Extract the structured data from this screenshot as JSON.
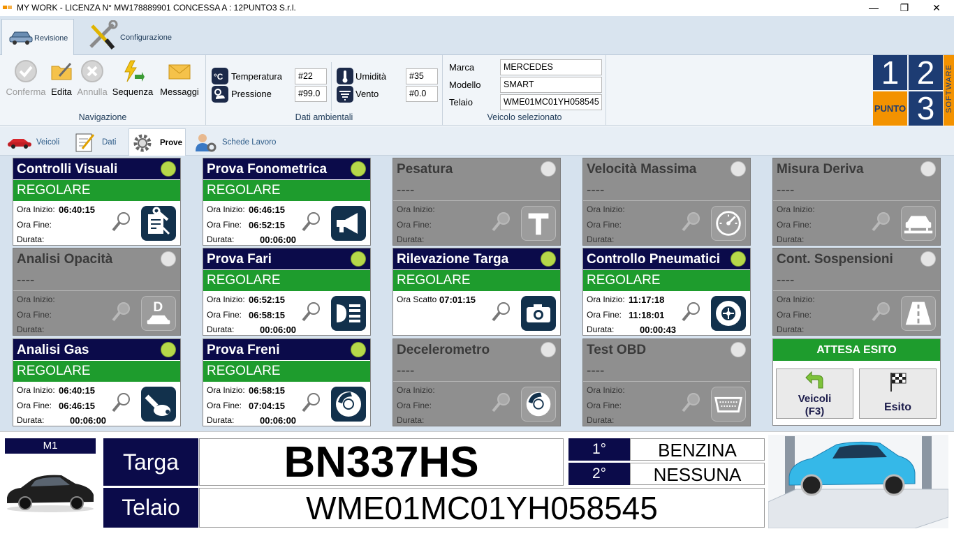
{
  "window": {
    "title": "MY WORK - LICENZA N° MW178889901 CONCESSA A : 12PUNTO3 S.r.l.",
    "minimize": "—",
    "restore": "❐",
    "close": "✕"
  },
  "ribbon_tabs": [
    {
      "label": "Revisione",
      "icon": "car-icon"
    },
    {
      "label": "Configurazione",
      "icon": "tools-icon"
    }
  ],
  "navigation": {
    "group_label": "Navigazione",
    "buttons": [
      {
        "label": "Conferma",
        "icon": "check-icon",
        "enabled": false
      },
      {
        "label": "Edita",
        "icon": "edit-folder-icon",
        "enabled": true
      },
      {
        "label": "Annulla",
        "icon": "cancel-icon",
        "enabled": false
      },
      {
        "label": "Sequenza",
        "icon": "lightning-arrow-icon",
        "enabled": true
      },
      {
        "label": "Messaggi",
        "icon": "envelope-icon",
        "enabled": true
      }
    ]
  },
  "ambient": {
    "group_label": "Dati ambientali",
    "temperatura": {
      "label": "Temperatura",
      "value": "#22"
    },
    "pressione": {
      "label": "Pressione",
      "value": "#99.0"
    },
    "umidita": {
      "label": "Umidità",
      "value": "#35"
    },
    "vento": {
      "label": "Vento",
      "value": "#0.0"
    }
  },
  "vehicle": {
    "group_label": "Veicolo selezionato",
    "marca": {
      "label": "Marca",
      "value": "MERCEDES"
    },
    "modello": {
      "label": "Modello",
      "value": "SMART"
    },
    "telaio": {
      "label": "Telaio",
      "value": "WME01MC01YH058545"
    }
  },
  "logo": {
    "one": "1",
    "two": "2",
    "three": "3",
    "punto": "PUNTO",
    "software": "SOFTWARE"
  },
  "subtabs": [
    {
      "label": "Veicoli"
    },
    {
      "label": "Dati"
    },
    {
      "label": "Prove"
    },
    {
      "label": "Schede Lavoro"
    }
  ],
  "row_labels": {
    "inizio": "Ora Inizio:",
    "fine": "Ora Fine:",
    "durata": "Durata:",
    "scatto": "Ora Scatto"
  },
  "cards": [
    {
      "title": "Controlli Visuali",
      "status": "REGOLARE",
      "active": true,
      "inizio": "06:40:15",
      "fine": "",
      "durata": "",
      "icon": "checklist-wrench-icon"
    },
    {
      "title": "Prova Fonometrica",
      "status": "REGOLARE",
      "active": true,
      "inizio": "06:46:15",
      "fine": "06:52:15",
      "durata": "00:06:00",
      "icon": "horn-icon"
    },
    {
      "title": "Pesatura",
      "status": "----",
      "active": false,
      "inizio": "",
      "fine": "",
      "durata": "",
      "icon": "weight-icon"
    },
    {
      "title": "Velocità Massima",
      "status": "----",
      "active": false,
      "inizio": "",
      "fine": "",
      "durata": "",
      "icon": "speedometer-icon"
    },
    {
      "title": "Misura Deriva",
      "status": "----",
      "active": false,
      "inizio": "",
      "fine": "",
      "durata": "",
      "icon": "car-lift-icon"
    },
    {
      "title": "Analisi Opacità",
      "status": "----",
      "active": false,
      "inizio": "",
      "fine": "",
      "durata": "",
      "icon": "diesel-car-icon"
    },
    {
      "title": "Prova Fari",
      "status": "REGOLARE",
      "active": true,
      "inizio": "06:52:15",
      "fine": "06:58:15",
      "durata": "00:06:00",
      "icon": "headlight-icon"
    },
    {
      "title": "Rilevazione Targa",
      "status": "REGOLARE",
      "active": true,
      "scatto": "07:01:15",
      "icon": "camera-icon"
    },
    {
      "title": "Controllo Pneumatici",
      "status": "REGOLARE",
      "active": true,
      "inizio": "11:17:18",
      "fine": "11:18:01",
      "durata": "00:00:43",
      "icon": "tire-icon"
    },
    {
      "title": "Cont. Sospensioni",
      "status": "----",
      "active": false,
      "inizio": "",
      "fine": "",
      "durata": "",
      "icon": "road-icon"
    },
    {
      "title": "Analisi Gas",
      "status": "REGOLARE",
      "active": true,
      "inizio": "06:40:15",
      "fine": "06:46:15",
      "durata": "00:06:00",
      "icon": "exhaust-icon"
    },
    {
      "title": "Prova Freni",
      "status": "REGOLARE",
      "active": true,
      "inizio": "06:58:15",
      "fine": "07:04:15",
      "durata": "00:06:00",
      "icon": "brake-disc-icon"
    },
    {
      "title": "Decelerometro",
      "status": "----",
      "active": false,
      "inizio": "",
      "fine": "",
      "durata": "",
      "icon": "brake-disc-icon"
    },
    {
      "title": "Test OBD",
      "status": "----",
      "active": false,
      "inizio": "",
      "fine": "",
      "durata": "",
      "icon": "obd-connector-icon"
    }
  ],
  "esito_panel": {
    "status": "ATTESA ESITO",
    "veicoli_button": "Veicoli\n(F3)",
    "esito_button": "Esito"
  },
  "bottom": {
    "line": "M1",
    "targa_label": "Targa",
    "targa": "BN337HS",
    "telaio_label": "Telaio",
    "telaio": "WME01MC01YH058545",
    "fuel1_label": "1°",
    "fuel1": "BENZINA",
    "fuel2_label": "2°",
    "fuel2": "NESSUNA"
  },
  "colors": {
    "navy": "#0b0b4a",
    "green": "#1e9c2d",
    "led_on": "#b6d84a",
    "card_off": "#8f8f8f",
    "logo_blue": "#1d3c73",
    "logo_orange": "#f39200"
  }
}
